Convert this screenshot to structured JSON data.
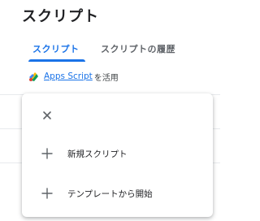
{
  "page": {
    "title": "スクリプト"
  },
  "tabs": [
    {
      "label": "スクリプト",
      "active": true
    },
    {
      "label": "スクリプトの履歴",
      "active": false
    }
  ],
  "promo": {
    "link_text": "Apps Script",
    "suffix": "を活用"
  },
  "menu": {
    "close_icon": "close-icon",
    "items": [
      {
        "icon": "plus-icon",
        "label": "新規スクリプト"
      },
      {
        "icon": "plus-icon",
        "label": "テンプレートから開始"
      }
    ]
  },
  "colors": {
    "accent": "#1a73e8",
    "text": "#202124",
    "muted": "#5f6368"
  }
}
